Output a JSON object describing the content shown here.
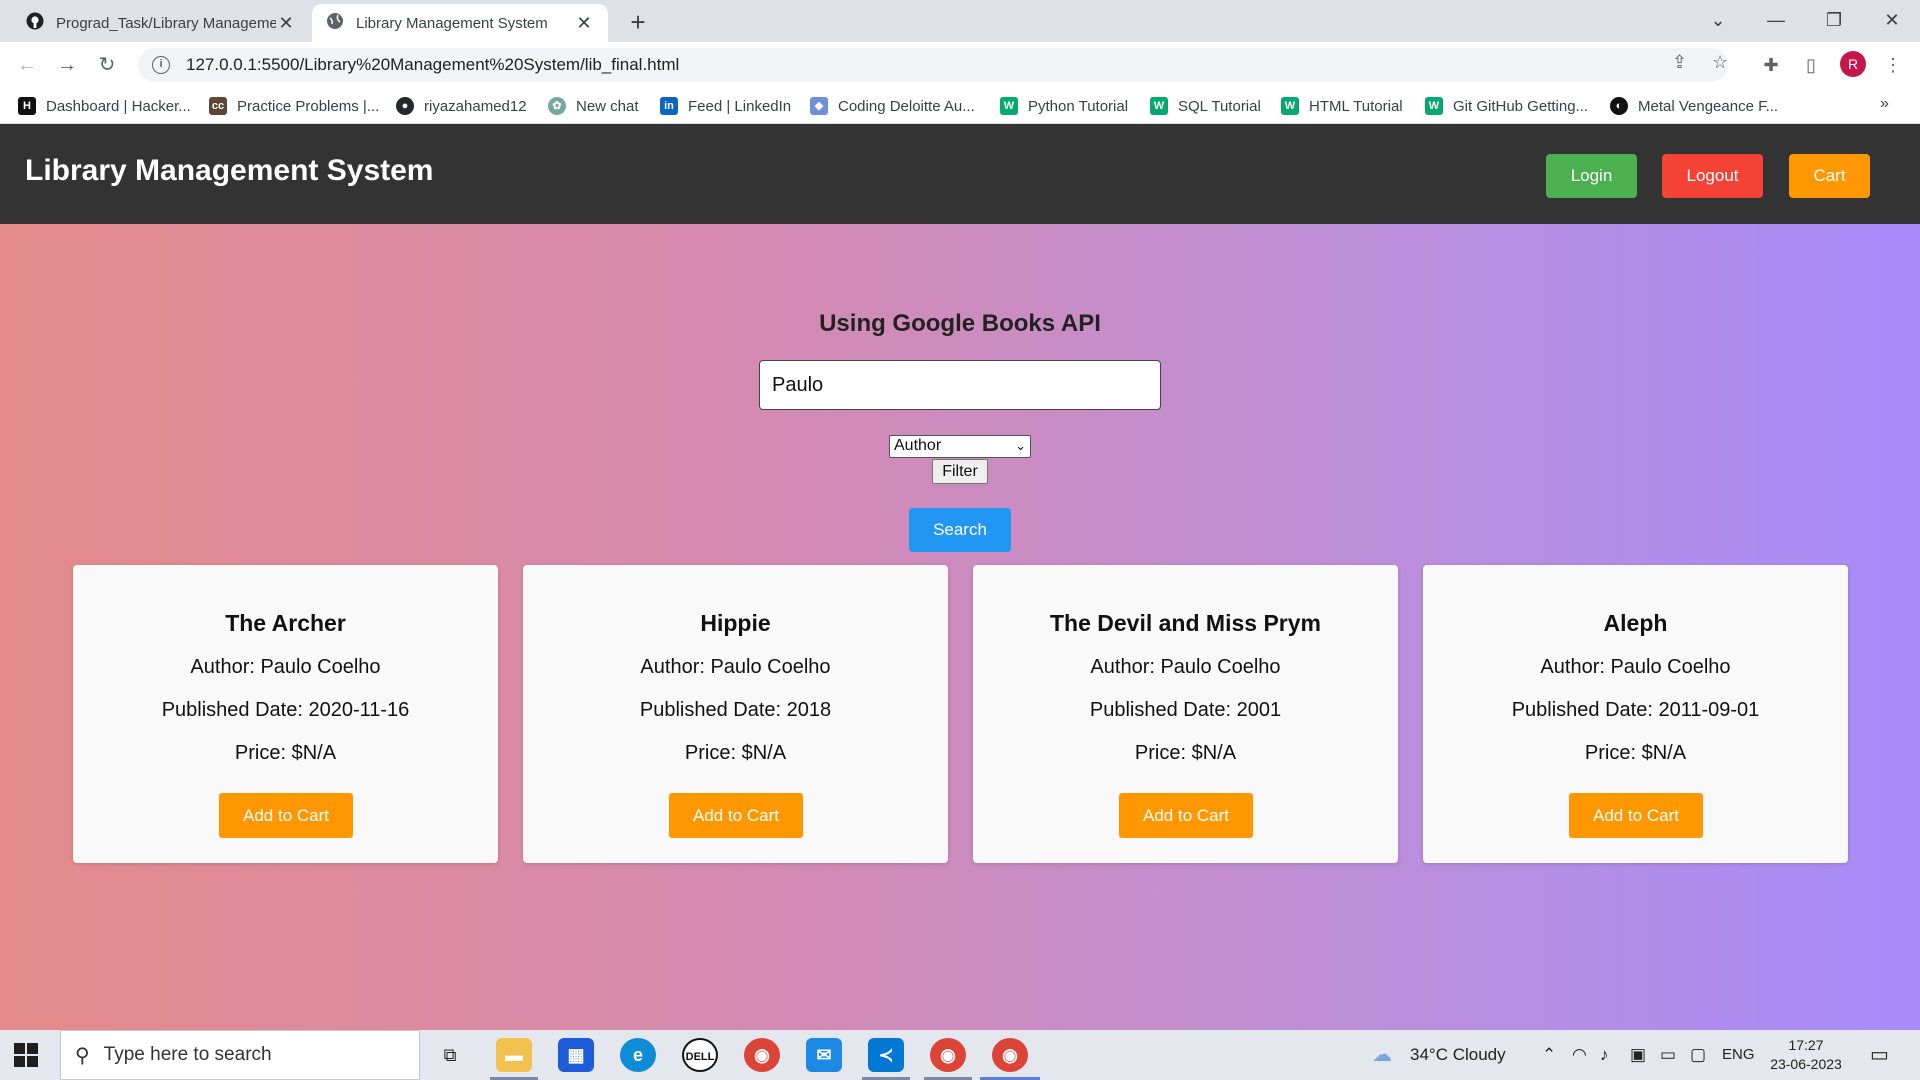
{
  "browser": {
    "tabs": [
      {
        "title": "Prograd_Task/Library Manageme",
        "icon": "github-icon",
        "active": false
      },
      {
        "title": "Library Management System",
        "icon": "globe-icon",
        "active": true
      }
    ],
    "url": "127.0.0.1:5500/Library%20Management%20System/lib_final.html",
    "profile_initial": "R",
    "bookmarks": [
      {
        "label": "Dashboard | Hacker...",
        "icon": "hackerrank-icon",
        "badge": "H",
        "color": "#111111"
      },
      {
        "label": "Practice Problems |...",
        "icon": "codechef-icon",
        "badge": "cc",
        "color": "#5b4638"
      },
      {
        "label": "riyazahamed12",
        "icon": "github-icon",
        "badge": "●",
        "color": "#24292e"
      },
      {
        "label": "New chat",
        "icon": "chatgpt-icon",
        "badge": "✿",
        "color": "#74aa9c"
      },
      {
        "label": "Feed | LinkedIn",
        "icon": "linkedin-icon",
        "badge": "in",
        "color": "#0a66c2"
      },
      {
        "label": "Coding Deloitte Au...",
        "icon": "diamond-icon",
        "badge": "◆",
        "color": "#6f8fd8"
      },
      {
        "label": "Python Tutorial",
        "icon": "w3schools-icon",
        "badge": "W",
        "color": "#04aa6d"
      },
      {
        "label": "SQL Tutorial",
        "icon": "w3schools-icon",
        "badge": "W",
        "color": "#04aa6d"
      },
      {
        "label": "HTML Tutorial",
        "icon": "w3schools-icon",
        "badge": "W",
        "color": "#04aa6d"
      },
      {
        "label": "Git GitHub Getting...",
        "icon": "w3schools-icon",
        "badge": "W",
        "color": "#04aa6d"
      },
      {
        "label": "Metal Vengeance F...",
        "icon": "disc-icon",
        "badge": "◐",
        "color": "#111111"
      }
    ]
  },
  "app": {
    "title": "Library Management System",
    "login_label": "Login",
    "logout_label": "Logout",
    "cart_label": "Cart"
  },
  "search": {
    "heading": "Using Google Books API",
    "query": "Paulo",
    "filter_selected": "Author",
    "filter_button": "Filter",
    "search_button": "Search"
  },
  "books": [
    {
      "title": "The Archer",
      "author": "Author: Paulo Coelho",
      "date": "Published Date: 2020-11-16",
      "price": "Price: $N/A",
      "button": "Add to Cart"
    },
    {
      "title": "Hippie",
      "author": "Author: Paulo Coelho",
      "date": "Published Date: 2018",
      "price": "Price: $N/A",
      "button": "Add to Cart"
    },
    {
      "title": "The Devil and Miss Prym",
      "author": "Author: Paulo Coelho",
      "date": "Published Date: 2001",
      "price": "Price: $N/A",
      "button": "Add to Cart"
    },
    {
      "title": "Aleph",
      "author": "Author: Paulo Coelho",
      "date": "Published Date: 2011-09-01",
      "price": "Price: $N/A",
      "button": "Add to Cart"
    }
  ],
  "taskbar": {
    "search_placeholder": "Type here to search",
    "weather": "34°C  Cloudy",
    "language": "ENG",
    "time": "17:27",
    "date": "23-06-2023"
  },
  "colors": {
    "header_bg": "#333333",
    "login": "#4caf50",
    "logout": "#f44336",
    "cart": "#ff9800",
    "search": "#2196f3"
  }
}
